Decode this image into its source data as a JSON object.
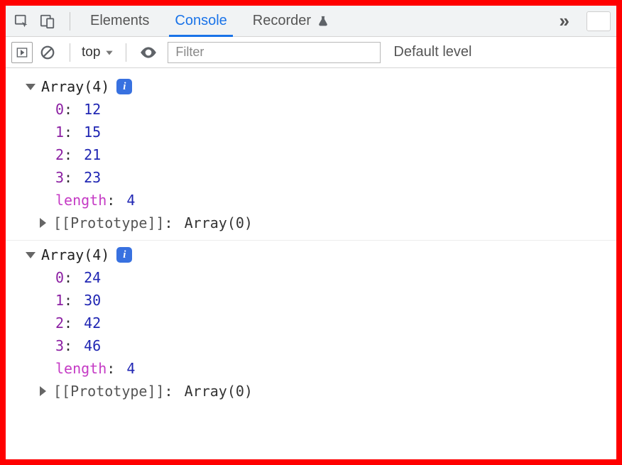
{
  "tabs": {
    "elements": "Elements",
    "console": "Console",
    "recorder": "Recorder"
  },
  "toolbar": {
    "context": "top",
    "filter_placeholder": "Filter",
    "levels_label": "Default level"
  },
  "info_badge_glyph": "i",
  "entries": [
    {
      "header": "Array(4)",
      "items": [
        {
          "key": "0",
          "value": "12"
        },
        {
          "key": "1",
          "value": "15"
        },
        {
          "key": "2",
          "value": "21"
        },
        {
          "key": "3",
          "value": "23"
        }
      ],
      "length_key": "length",
      "length_value": "4",
      "proto_label": "[[Prototype]]",
      "proto_value": "Array(0)"
    },
    {
      "header": "Array(4)",
      "items": [
        {
          "key": "0",
          "value": "24"
        },
        {
          "key": "1",
          "value": "30"
        },
        {
          "key": "2",
          "value": "42"
        },
        {
          "key": "3",
          "value": "46"
        }
      ],
      "length_key": "length",
      "length_value": "4",
      "proto_label": "[[Prototype]]",
      "proto_value": "Array(0)"
    }
  ]
}
